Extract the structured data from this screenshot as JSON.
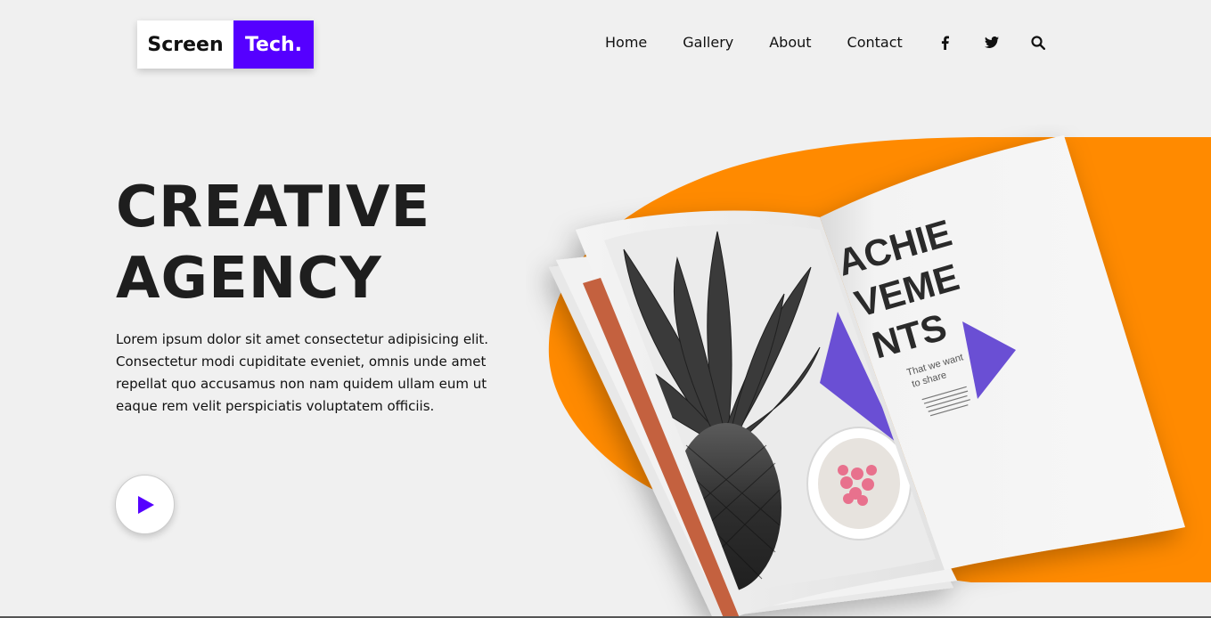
{
  "header": {
    "logo": {
      "part1": "Screen",
      "part2": "Tech."
    },
    "nav": {
      "items": [
        {
          "label": "Home"
        },
        {
          "label": "Gallery"
        },
        {
          "label": "About"
        },
        {
          "label": "Contact"
        }
      ],
      "icons": [
        "facebook-icon",
        "twitter-icon",
        "search-icon"
      ]
    }
  },
  "hero": {
    "title_line1": "CREATIVE",
    "title_line2": "AGENCY",
    "description": "Lorem ipsum dolor sit amet consectetur adipisicing elit. Consectetur modi cupiditate eveniet, omnis unde amet repellat quo accusamus non nam quidem ullam eum ut eaque rem velit perspiciatis voluptatem officiis.",
    "play_icon": "play-icon"
  },
  "magazine": {
    "headline_line1": "ACHIE",
    "headline_line2": "VEME",
    "headline_line3": "NTS",
    "tagline_line1": "That we want",
    "tagline_line2": "to share"
  },
  "colors": {
    "brand": "#5500ff",
    "accent_orange": "#ff8a00",
    "dark_text": "#1e1e1e",
    "background": "#f0f0f0",
    "triangle": "#6a4fd4",
    "orange_strip": "#c4613f"
  }
}
